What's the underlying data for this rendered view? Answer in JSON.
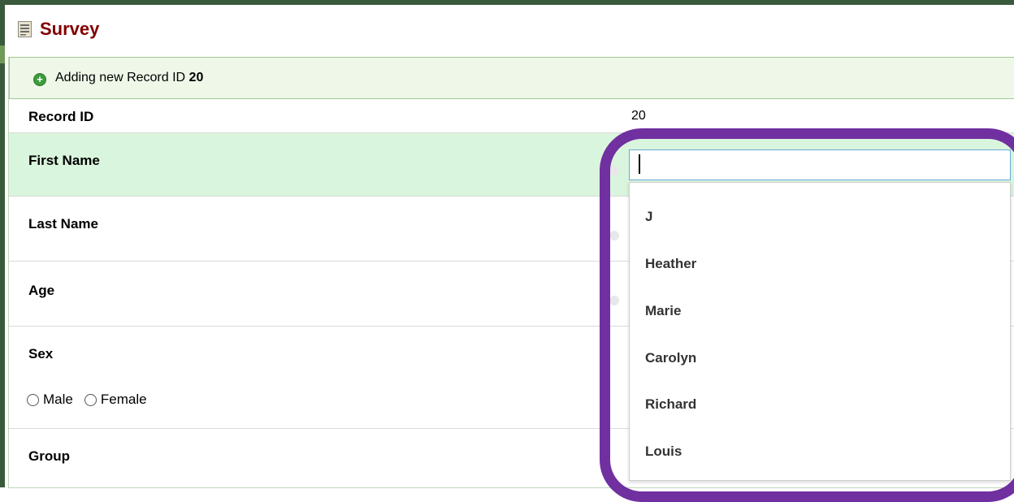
{
  "page": {
    "title": "Survey",
    "icon": "form-icon"
  },
  "header": {
    "icon": "add-circle-icon",
    "plus_glyph": "+",
    "prefix": "Adding new Record ID",
    "record_id": "20"
  },
  "fields": {
    "record_id": {
      "label": "Record ID",
      "value": "20"
    },
    "first_name": {
      "label": "First Name",
      "value": ""
    },
    "last_name": {
      "label": "Last Name"
    },
    "age": {
      "label": "Age"
    },
    "sex": {
      "label": "Sex",
      "options": [
        "Male",
        "Female"
      ]
    },
    "group": {
      "label": "Group"
    }
  },
  "autocomplete": {
    "suggestions": [
      "J",
      "Heather",
      "Marie",
      "Carolyn",
      "Richard",
      "Louis"
    ]
  },
  "colors": {
    "title": "#800000",
    "active_row": "#daf5dd",
    "header_bg": "#eef7e8",
    "highlight": "#7030a0"
  }
}
